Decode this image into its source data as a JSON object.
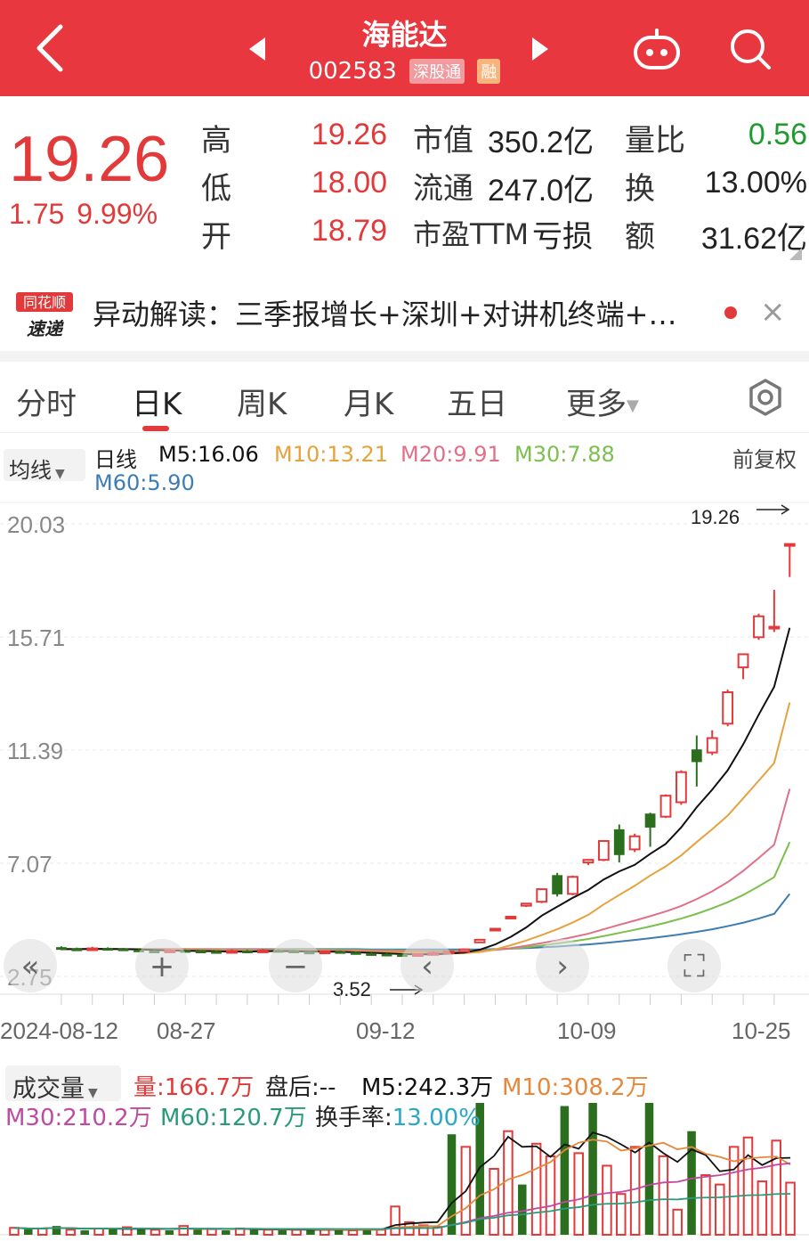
{
  "header": {
    "title": "海能达",
    "code": "002583",
    "badge_hk": "深股通",
    "badge_rong": "融"
  },
  "quote": {
    "price": "19.26",
    "change": "1.75",
    "change_pct": "9.99%",
    "rows": [
      {
        "l1": "高",
        "v1": "19.26",
        "l2": "市值",
        "v2": "350.2亿",
        "l3": "量比",
        "v3": "0.56"
      },
      {
        "l1": "低",
        "v1": "18.00",
        "l2": "流通",
        "v2": "247.0亿",
        "l3": "换",
        "v3": "13.00%"
      },
      {
        "l1": "开",
        "v1": "18.79",
        "l2": "市盈TTM",
        "v2": "亏损",
        "l3": "额",
        "v3": "31.62亿"
      }
    ]
  },
  "news": {
    "logo_line1": "同花顺",
    "logo_line2": "速递",
    "text": "异动解读：三季报增长+深圳+对讲机终端+…",
    "close": "×"
  },
  "tabs": [
    "分时",
    "日K",
    "周K",
    "月K",
    "五日",
    "更多"
  ],
  "ma_info": {
    "button": "均线",
    "label": "日线",
    "m5": "M5:16.06",
    "m10": "M10:13.21",
    "m20": "M20:9.91",
    "m30": "M30:7.88",
    "m60": "M60:5.90",
    "fq": "前复权"
  },
  "colors": {
    "up": "#e23a3a",
    "down": "#2a6e1e",
    "m5": "#111111",
    "m10": "#e6a23c",
    "m20": "#e0708a",
    "m30": "#7bbf4f",
    "m60": "#3d7db3"
  },
  "chart_data": {
    "type": "candlestick",
    "y_ticks": [
      "20.03",
      "15.71",
      "11.39",
      "7.07",
      "2.75"
    ],
    "ylim": [
      2.75,
      20.03
    ],
    "x_labels": [
      "2024-08-12",
      "08-27",
      "09-12",
      "10-09",
      "10-25"
    ],
    "max_label": "19.26",
    "min_label": "3.52",
    "candles": [
      {
        "o": 3.85,
        "c": 3.8,
        "h": 3.9,
        "l": 3.75
      },
      {
        "o": 3.8,
        "c": 3.78,
        "h": 3.85,
        "l": 3.72
      },
      {
        "o": 3.78,
        "c": 3.82,
        "h": 3.88,
        "l": 3.74
      },
      {
        "o": 3.82,
        "c": 3.8,
        "h": 3.86,
        "l": 3.76
      },
      {
        "o": 3.8,
        "c": 3.76,
        "h": 3.84,
        "l": 3.72
      },
      {
        "o": 3.76,
        "c": 3.72,
        "h": 3.8,
        "l": 3.68
      },
      {
        "o": 3.72,
        "c": 3.7,
        "h": 3.76,
        "l": 3.66
      },
      {
        "o": 3.7,
        "c": 3.74,
        "h": 3.8,
        "l": 3.68
      },
      {
        "o": 3.74,
        "c": 3.72,
        "h": 3.78,
        "l": 3.68
      },
      {
        "o": 3.72,
        "c": 3.7,
        "h": 3.76,
        "l": 3.66
      },
      {
        "o": 3.7,
        "c": 3.68,
        "h": 3.74,
        "l": 3.64
      },
      {
        "o": 3.68,
        "c": 3.72,
        "h": 3.78,
        "l": 3.66
      },
      {
        "o": 3.72,
        "c": 3.7,
        "h": 3.76,
        "l": 3.66
      },
      {
        "o": 3.7,
        "c": 3.74,
        "h": 3.8,
        "l": 3.68
      },
      {
        "o": 3.74,
        "c": 3.72,
        "h": 3.78,
        "l": 3.68
      },
      {
        "o": 3.72,
        "c": 3.68,
        "h": 3.76,
        "l": 3.64
      },
      {
        "o": 3.68,
        "c": 3.66,
        "h": 3.72,
        "l": 3.62
      },
      {
        "o": 3.66,
        "c": 3.7,
        "h": 3.74,
        "l": 3.64
      },
      {
        "o": 3.7,
        "c": 3.66,
        "h": 3.74,
        "l": 3.62
      },
      {
        "o": 3.66,
        "c": 3.62,
        "h": 3.7,
        "l": 3.58
      },
      {
        "o": 3.62,
        "c": 3.6,
        "h": 3.66,
        "l": 3.56
      },
      {
        "o": 3.6,
        "c": 3.58,
        "h": 3.64,
        "l": 3.54
      },
      {
        "o": 3.58,
        "c": 3.56,
        "h": 3.62,
        "l": 3.52
      },
      {
        "o": 3.56,
        "c": 3.6,
        "h": 3.64,
        "l": 3.54
      },
      {
        "o": 3.6,
        "c": 3.64,
        "h": 3.7,
        "l": 3.58
      },
      {
        "o": 3.64,
        "c": 3.7,
        "h": 3.74,
        "l": 3.62
      },
      {
        "o": 3.7,
        "c": 3.78,
        "h": 3.82,
        "l": 3.68
      },
      {
        "o": 4.05,
        "c": 4.15,
        "h": 4.16,
        "l": 4.05
      },
      {
        "o": 4.55,
        "c": 4.57,
        "h": 4.57,
        "l": 4.55
      },
      {
        "o": 5.0,
        "c": 5.03,
        "h": 5.03,
        "l": 5.0
      },
      {
        "o": 5.45,
        "c": 5.53,
        "h": 5.55,
        "l": 5.4
      },
      {
        "o": 5.6,
        "c": 6.08,
        "h": 6.1,
        "l": 5.55
      },
      {
        "o": 6.6,
        "c": 5.9,
        "h": 6.7,
        "l": 5.8
      },
      {
        "o": 5.9,
        "c": 6.55,
        "h": 6.6,
        "l": 5.85
      },
      {
        "o": 7.1,
        "c": 7.2,
        "h": 7.21,
        "l": 7.0
      },
      {
        "o": 7.2,
        "c": 7.92,
        "h": 7.95,
        "l": 7.15
      },
      {
        "o": 8.35,
        "c": 7.4,
        "h": 8.55,
        "l": 7.1
      },
      {
        "o": 7.6,
        "c": 8.1,
        "h": 8.2,
        "l": 7.5
      },
      {
        "o": 8.95,
        "c": 8.45,
        "h": 9.0,
        "l": 7.7
      },
      {
        "o": 8.85,
        "c": 9.65,
        "h": 9.7,
        "l": 8.8
      },
      {
        "o": 9.4,
        "c": 10.55,
        "h": 10.62,
        "l": 9.3
      },
      {
        "o": 11.4,
        "c": 10.95,
        "h": 11.95,
        "l": 10.0
      },
      {
        "o": 11.3,
        "c": 11.85,
        "h": 12.15,
        "l": 11.2
      },
      {
        "o": 12.4,
        "c": 13.6,
        "h": 13.7,
        "l": 12.3
      },
      {
        "o": 14.55,
        "c": 15.05,
        "h": 15.05,
        "l": 14.1
      },
      {
        "o": 15.7,
        "c": 16.5,
        "h": 16.6,
        "l": 15.6
      },
      {
        "o": 16.1,
        "c": 16.1,
        "h": 17.51,
        "l": 15.9
      },
      {
        "o": 19.2,
        "c": 19.26,
        "h": 19.26,
        "l": 18.0
      }
    ],
    "ma_series": {
      "m5": [
        3.79,
        3.79,
        3.8,
        3.8,
        3.79,
        3.78,
        3.76,
        3.74,
        3.73,
        3.72,
        3.71,
        3.7,
        3.7,
        3.71,
        3.72,
        3.71,
        3.7,
        3.7,
        3.69,
        3.67,
        3.65,
        3.63,
        3.6,
        3.59,
        3.59,
        3.62,
        3.66,
        3.77,
        3.97,
        4.26,
        4.62,
        5.07,
        5.41,
        5.75,
        6.05,
        6.45,
        6.76,
        7.01,
        7.43,
        7.81,
        8.44,
        9.21,
        9.88,
        10.62,
        11.61,
        12.74,
        13.81,
        16.06
      ],
      "m10": [
        3.79,
        3.79,
        3.79,
        3.8,
        3.79,
        3.79,
        3.78,
        3.77,
        3.76,
        3.75,
        3.75,
        3.74,
        3.73,
        3.73,
        3.73,
        3.72,
        3.72,
        3.72,
        3.71,
        3.7,
        3.69,
        3.67,
        3.66,
        3.65,
        3.64,
        3.63,
        3.64,
        3.68,
        3.78,
        3.94,
        4.12,
        4.33,
        4.55,
        4.81,
        5.1,
        5.5,
        5.86,
        6.21,
        6.6,
        6.95,
        7.37,
        7.88,
        8.37,
        8.89,
        9.55,
        10.22,
        10.9,
        13.21
      ],
      "m20": [
        3.79,
        3.79,
        3.79,
        3.79,
        3.79,
        3.79,
        3.79,
        3.79,
        3.79,
        3.78,
        3.78,
        3.77,
        3.77,
        3.76,
        3.76,
        3.75,
        3.75,
        3.75,
        3.74,
        3.74,
        3.73,
        3.72,
        3.71,
        3.71,
        3.7,
        3.7,
        3.7,
        3.72,
        3.76,
        3.83,
        3.92,
        4.02,
        4.13,
        4.25,
        4.38,
        4.55,
        4.72,
        4.88,
        5.05,
        5.23,
        5.44,
        5.7,
        6.0,
        6.35,
        6.78,
        7.27,
        7.78,
        9.91
      ],
      "m30": [
        3.79,
        3.79,
        3.79,
        3.79,
        3.79,
        3.79,
        3.79,
        3.79,
        3.79,
        3.79,
        3.79,
        3.78,
        3.78,
        3.78,
        3.78,
        3.77,
        3.77,
        3.77,
        3.76,
        3.76,
        3.75,
        3.75,
        3.74,
        3.74,
        3.73,
        3.73,
        3.73,
        3.74,
        3.77,
        3.81,
        3.86,
        3.93,
        4.01,
        4.09,
        4.18,
        4.29,
        4.41,
        4.53,
        4.66,
        4.8,
        4.96,
        5.14,
        5.35,
        5.58,
        5.86,
        6.19,
        6.54,
        7.88
      ],
      "m60": [
        3.79,
        3.79,
        3.79,
        3.79,
        3.79,
        3.79,
        3.79,
        3.79,
        3.79,
        3.79,
        3.79,
        3.79,
        3.79,
        3.79,
        3.79,
        3.79,
        3.79,
        3.79,
        3.79,
        3.79,
        3.78,
        3.78,
        3.78,
        3.78,
        3.78,
        3.78,
        3.78,
        3.78,
        3.79,
        3.81,
        3.83,
        3.86,
        3.89,
        3.93,
        3.97,
        4.02,
        4.08,
        4.14,
        4.21,
        4.28,
        4.36,
        4.45,
        4.55,
        4.67,
        4.8,
        4.96,
        5.14,
        5.9
      ]
    }
  },
  "volume_info": {
    "button": "成交量",
    "vol": "量:166.7万",
    "after": "盘后:--",
    "m5": "M5:242.3万",
    "m10": "M10:308.2万",
    "m30": "M30:210.2万",
    "m60": "M60:120.7万",
    "turnover_label": "换手率:",
    "turnover": "13.00%"
  },
  "volume_data": {
    "unit": "万",
    "vmax": 420,
    "bars": [
      22,
      18,
      20,
      28,
      16,
      14,
      20,
      18,
      24,
      18,
      16,
      14,
      28,
      16,
      18,
      14,
      20,
      18,
      16,
      14,
      16,
      14,
      18,
      16,
      14,
      18,
      16,
      90,
      40,
      30,
      25,
      320,
      280,
      420,
      210,
      330,
      160,
      290,
      250,
      410,
      260,
      420,
      220,
      130,
      280,
      420,
      250,
      80,
      330,
      190,
      160,
      280,
      310,
      170,
      300,
      166
    ]
  }
}
